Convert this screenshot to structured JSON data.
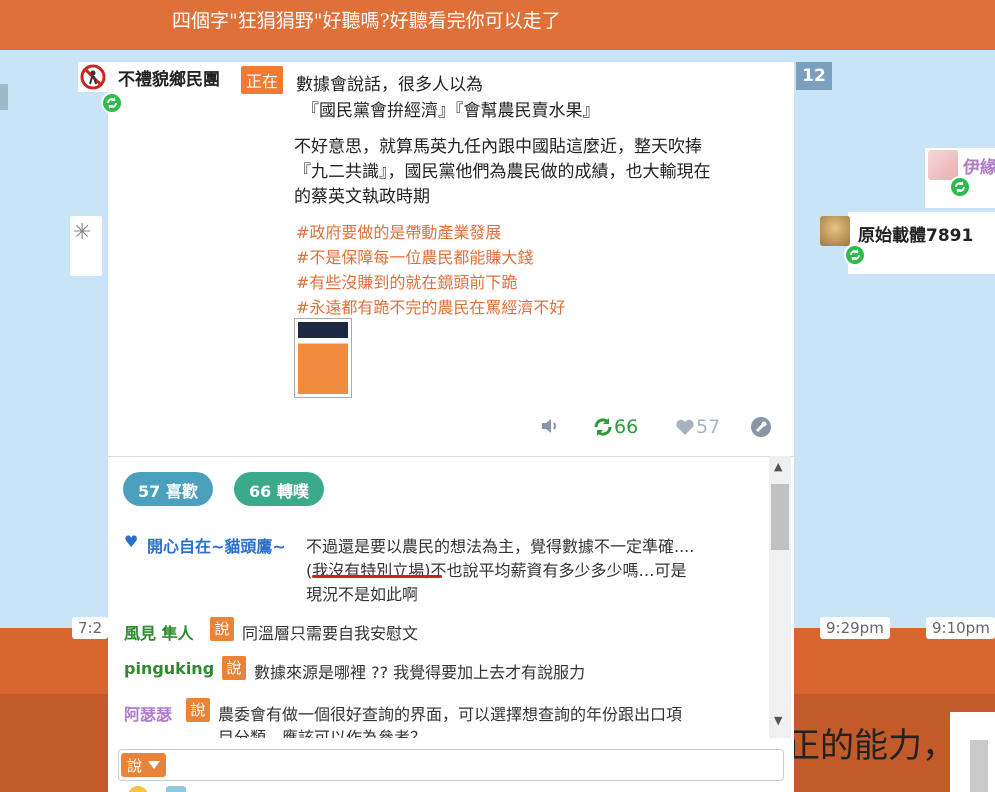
{
  "header": {
    "title": "四個字\"狂狷狷野\"好聽嗎?好聽看完你可以走了"
  },
  "post": {
    "author": "不禮貌鄉民團",
    "status_badge": "正在",
    "count_chip": "12",
    "lines": [
      "數據會說話，很多人以為",
      "『國民黨會拚經濟』『會幫農民賣水果』",
      "不好意思，就算馬英九任內跟中國貼這麼近，整天吹捧",
      "『九二共識』，國民黨他們為農民做的成績，也大輸現在",
      "的蔡英文執政時期"
    ],
    "hashtags": [
      "#政府要做的是帶動產業發展",
      "#不是保障每一位農民都能賺大錢",
      "#有些沒賺到的就在鏡頭前下跪",
      "#永遠都有跪不完的農民在罵經濟不好"
    ],
    "replurk_count": "66",
    "like_count": "57"
  },
  "side_users": [
    {
      "name": "伊緣"
    },
    {
      "name": "原始載體7891"
    }
  ],
  "times": [
    "7:2",
    "9:29pm",
    "9:10pm"
  ],
  "background_text": "正的能力，",
  "pills": {
    "likes": "57 喜歡",
    "replurks": "66 轉噗"
  },
  "comments": [
    {
      "name": "開心自在~貓頭鷹~",
      "heart": "♥",
      "lines": [
        "不過還是要以農民的想法為主，覺得數據不一定準確....",
        "(我沒有特別立場)不也說平均薪資有多少多少嗎…可是",
        "現況不是如此啊"
      ]
    },
    {
      "name": "風見 隼人",
      "say": "說",
      "text": "同溫層只需要自我安慰文"
    },
    {
      "name": "pinguking",
      "say": "說",
      "text": "數據來源是哪裡 ?? 我覺得要加上去才有說服力"
    },
    {
      "name": "阿瑟瑟",
      "say": "說",
      "lines": [
        "農委會有做一個很好查詢的界面，可以選擇想查詢的年份跟出口項",
        "目分類，應該可以作為參考？"
      ]
    }
  ],
  "input": {
    "say_label": "說"
  },
  "colors": {
    "brand_orange": "#e0703a",
    "replurk_green": "#2d9a3c",
    "hashtag_orange": "#e0703a",
    "comment_blue": "#2a6fc9",
    "comment_green": "#2d8a2d",
    "comment_purple": "#b07cc9"
  }
}
